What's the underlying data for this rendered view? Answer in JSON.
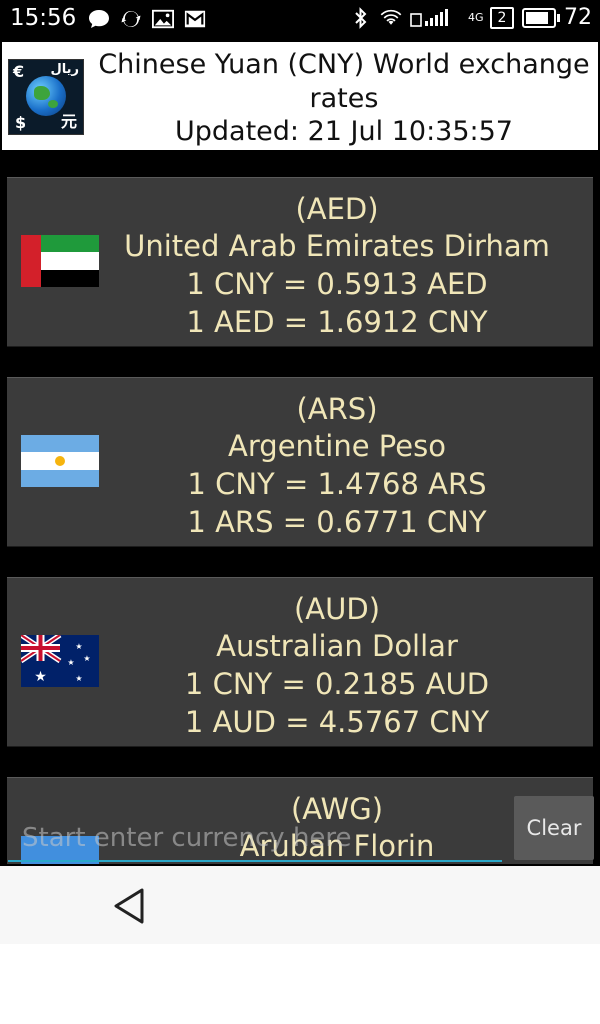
{
  "status_bar": {
    "time": "15:56",
    "network": "4G",
    "sim_slot": "2",
    "battery": "72"
  },
  "header": {
    "title": "Chinese Yuan (CNY) World exchange rates",
    "updated": "Updated: 21 Jul 10:35:57",
    "logo_symbols": [
      "€",
      "ریال",
      "$",
      "元"
    ]
  },
  "currencies": [
    {
      "code": "(AED)",
      "name": "United Arab Emirates Dirham",
      "rate_from": "1 CNY = 0.5913 AED",
      "rate_to": "1 AED = 1.6912 CNY"
    },
    {
      "code": "(ARS)",
      "name": "Argentine Peso",
      "rate_from": "1 CNY = 1.4768 ARS",
      "rate_to": "1 ARS = 0.6771 CNY"
    },
    {
      "code": "(AUD)",
      "name": "Australian Dollar",
      "rate_from": "1 CNY = 0.2185 AUD",
      "rate_to": "1 AUD = 4.5767 CNY"
    },
    {
      "code": "(AWG)",
      "name": "Aruban Florin"
    }
  ],
  "search": {
    "placeholder": "Start enter currency here",
    "clear_label": "Clear"
  },
  "colors": {
    "card_text": "#f0e6b8",
    "card_bg": "#3b3b3b",
    "accent": "#2aa8c9"
  }
}
